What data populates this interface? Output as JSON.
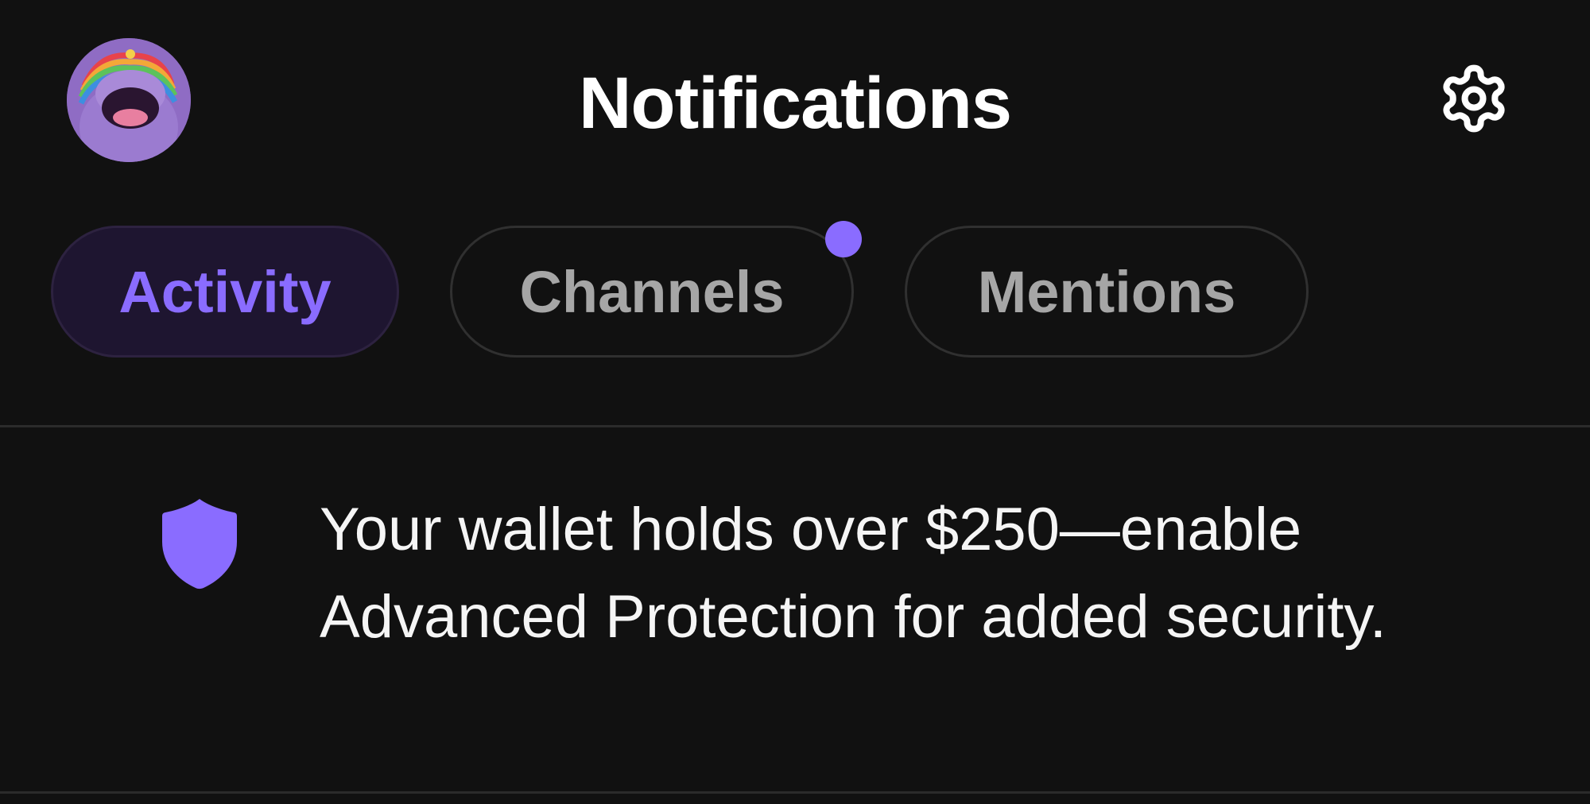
{
  "header": {
    "title": "Notifications",
    "avatar_icon": "avatar",
    "settings_icon": "gear-icon"
  },
  "tabs": [
    {
      "label": "Activity",
      "active": true
    },
    {
      "label": "Channels",
      "active": false,
      "has_unread_dot": true
    },
    {
      "label": "Mentions",
      "active": false
    }
  ],
  "notifications": [
    {
      "icon": "shield-icon",
      "text": "Your wallet holds over $250—enable Advanced Protection for added security."
    }
  ],
  "colors": {
    "background": "#111111",
    "accent": "#8a6cff",
    "active_tab_bg": "#1e1530",
    "inactive_text": "#a6a6a6",
    "text": "#f5f5f5"
  }
}
